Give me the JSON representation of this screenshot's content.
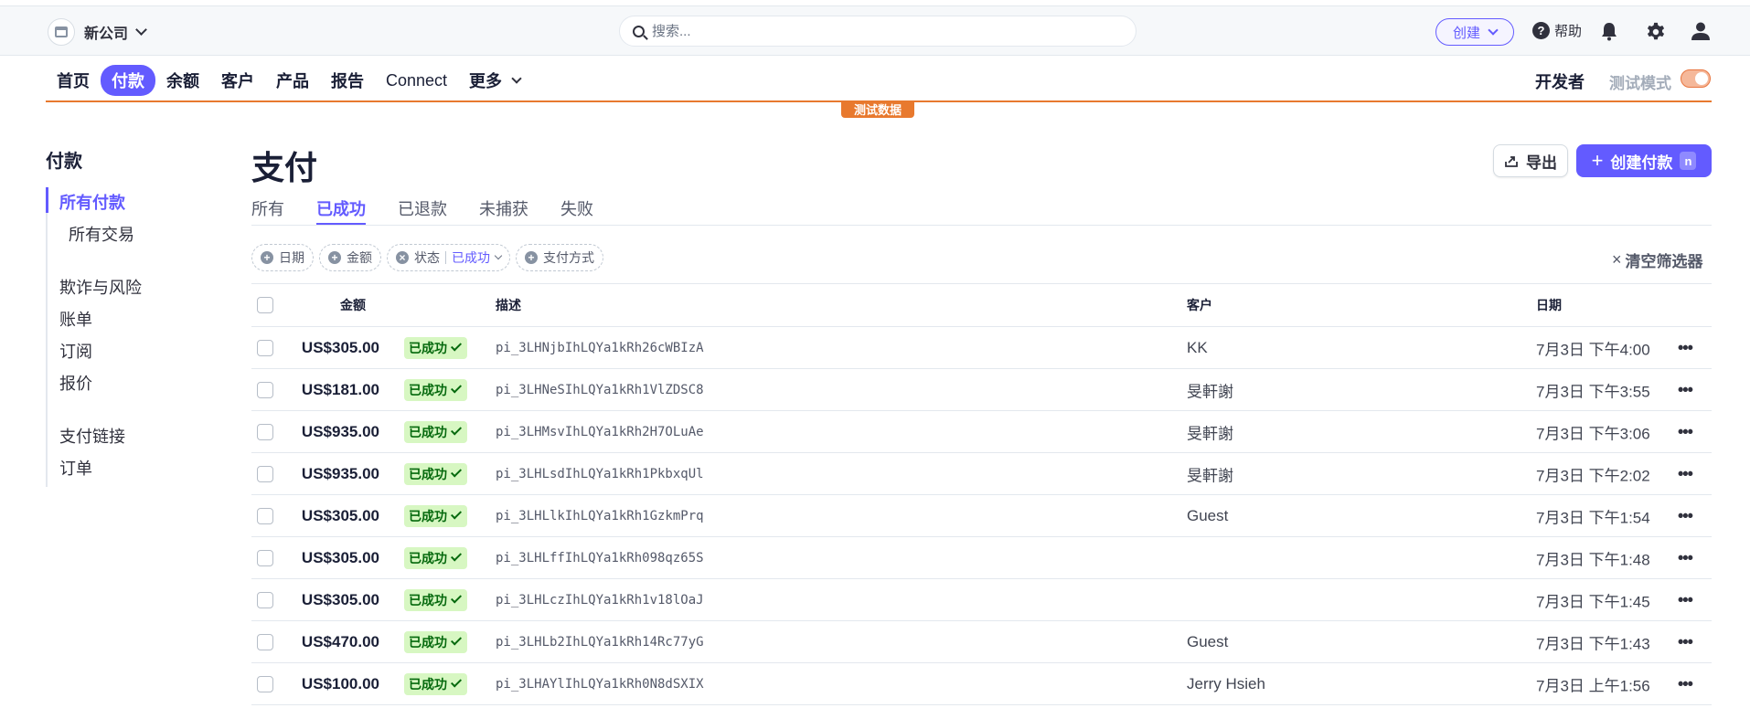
{
  "topbar": {
    "company_name": "新公司",
    "search_placeholder": "搜索...",
    "create_label": "创建",
    "help_label": "帮助"
  },
  "mainnav": {
    "items": [
      "首页",
      "付款",
      "余额",
      "客户",
      "产品",
      "报告",
      "Connect"
    ],
    "active_index": 1,
    "more_label": "更多",
    "developer_label": "开发者",
    "test_mode_label": "测试模式",
    "test_data_badge": "测试数据"
  },
  "sidebar": {
    "title": "付款",
    "items": [
      "所有付款",
      "所有交易",
      "欺诈与风险",
      "账单",
      "订阅",
      "报价",
      "支付链接",
      "订单"
    ]
  },
  "header": {
    "title": "支付",
    "export_label": "导出",
    "create_payment_label": "创建付款",
    "create_shortcut": "n"
  },
  "tabs": [
    "所有",
    "已成功",
    "已退款",
    "未捕获",
    "失败"
  ],
  "filters": {
    "date": "日期",
    "amount": "金额",
    "status": "状态",
    "status_value": "已成功",
    "payment_method": "支付方式",
    "clear_label": "清空筛选器"
  },
  "table": {
    "headers": {
      "amount": "金额",
      "description": "描述",
      "customer": "客户",
      "date": "日期"
    },
    "rows": [
      {
        "amount": "US$305.00",
        "status": "已成功",
        "description": "pi_3LHNjbIhLQYa1kRh26cWBIzA",
        "customer": "KK",
        "date": "7月3日 下午4:00"
      },
      {
        "amount": "US$181.00",
        "status": "已成功",
        "description": "pi_3LHNeSIhLQYa1kRh1VlZDSC8",
        "customer": "旻軒謝",
        "date": "7月3日 下午3:55"
      },
      {
        "amount": "US$935.00",
        "status": "已成功",
        "description": "pi_3LHMsvIhLQYa1kRh2H7OLuAe",
        "customer": "旻軒謝",
        "date": "7月3日 下午3:06"
      },
      {
        "amount": "US$935.00",
        "status": "已成功",
        "description": "pi_3LHLsdIhLQYa1kRh1PkbxqUl",
        "customer": "旻軒謝",
        "date": "7月3日 下午2:02"
      },
      {
        "amount": "US$305.00",
        "status": "已成功",
        "description": "pi_3LHLlkIhLQYa1kRh1GzkmPrq",
        "customer": "Guest",
        "date": "7月3日 下午1:54"
      },
      {
        "amount": "US$305.00",
        "status": "已成功",
        "description": "pi_3LHLffIhLQYa1kRh098qz65S",
        "customer": "",
        "date": "7月3日 下午1:48"
      },
      {
        "amount": "US$305.00",
        "status": "已成功",
        "description": "pi_3LHLczIhLQYa1kRh1v18lOaJ",
        "customer": "",
        "date": "7月3日 下午1:45"
      },
      {
        "amount": "US$470.00",
        "status": "已成功",
        "description": "pi_3LHLb2IhLQYa1kRh14Rc77yG",
        "customer": "Guest",
        "date": "7月3日 下午1:43"
      },
      {
        "amount": "US$100.00",
        "status": "已成功",
        "description": "pi_3LHAYlIhLQYa1kRh0N8dSXIX",
        "customer": "Jerry Hsieh",
        "date": "7月3日 上午1:56"
      }
    ]
  },
  "colors": {
    "accent": "#635bff",
    "test_orange": "#e8792e",
    "success_bg": "#d7f7c2",
    "success_text": "#05690d"
  }
}
